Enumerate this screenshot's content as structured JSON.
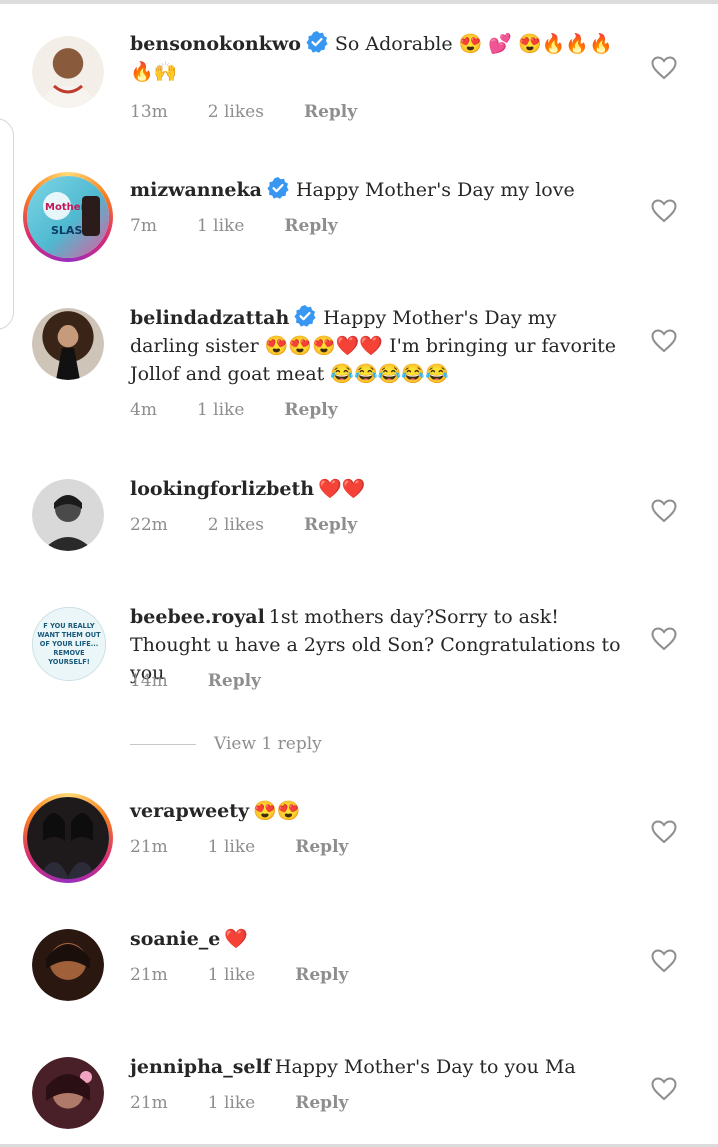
{
  "comments": [
    {
      "username": "bensonokonkwo",
      "verified": true,
      "text": "So Adorable 😍 💕 😍🔥🔥🔥🔥🙌",
      "time": "13m",
      "likes": "2 likes",
      "reply": "Reply",
      "avatar_color": "#b88a6a",
      "story_ring": false
    },
    {
      "username": "mizwanneka",
      "verified": true,
      "text": "Happy Mother's Day my love",
      "time": "7m",
      "likes": "1 like",
      "reply": "Reply",
      "avatar_color": "#6cc7d9",
      "story_ring": true
    },
    {
      "username": "belindadzattah",
      "verified": true,
      "text": "Happy Mother's Day my darling sister 😍😍😍❤️❤️ I'm bringing ur favorite Jollof and goat meat 😂😂😂😂😂",
      "time": "4m",
      "likes": "1 like",
      "reply": "Reply",
      "avatar_color": "#5a3a2e",
      "story_ring": false
    },
    {
      "username": "lookingforlizbeth",
      "verified": false,
      "text": "❤️❤️",
      "time": "22m",
      "likes": "2 likes",
      "reply": "Reply",
      "avatar_color": "#3a3a3a",
      "story_ring": false
    },
    {
      "username": "beebee.royal",
      "verified": false,
      "text": "1st mothers day?Sorry to ask! Thought u have a 2yrs old Son?  Congratulations to you",
      "time": "14m",
      "likes": "",
      "reply": "Reply",
      "avatar_color": "#e8f4f6",
      "story_ring": false,
      "avatar_text": "F YOU REALLY WANT THEM OUT OF YOUR LIFE... REMOVE YOURSELF!"
    },
    {
      "username": "verapweety",
      "verified": false,
      "text": "😍😍",
      "time": "21m",
      "likes": "1 like",
      "reply": "Reply",
      "avatar_color": "#2a1f24",
      "story_ring": true
    },
    {
      "username": "soanie_e",
      "verified": false,
      "text": "❤️",
      "time": "21m",
      "likes": "1 like",
      "reply": "Reply",
      "avatar_color": "#6b3a22",
      "story_ring": false
    },
    {
      "username": "jennipha_self",
      "verified": false,
      "text": "Happy Mother's Day to you Ma",
      "time": "21m",
      "likes": "1 like",
      "reply": "Reply",
      "avatar_color": "#8a4a52",
      "story_ring": false
    }
  ],
  "view_replies": "View 1 reply",
  "colors": {
    "verified_blue": "#3897f0",
    "meta_gray": "#8e8e8e",
    "text": "#262626"
  }
}
